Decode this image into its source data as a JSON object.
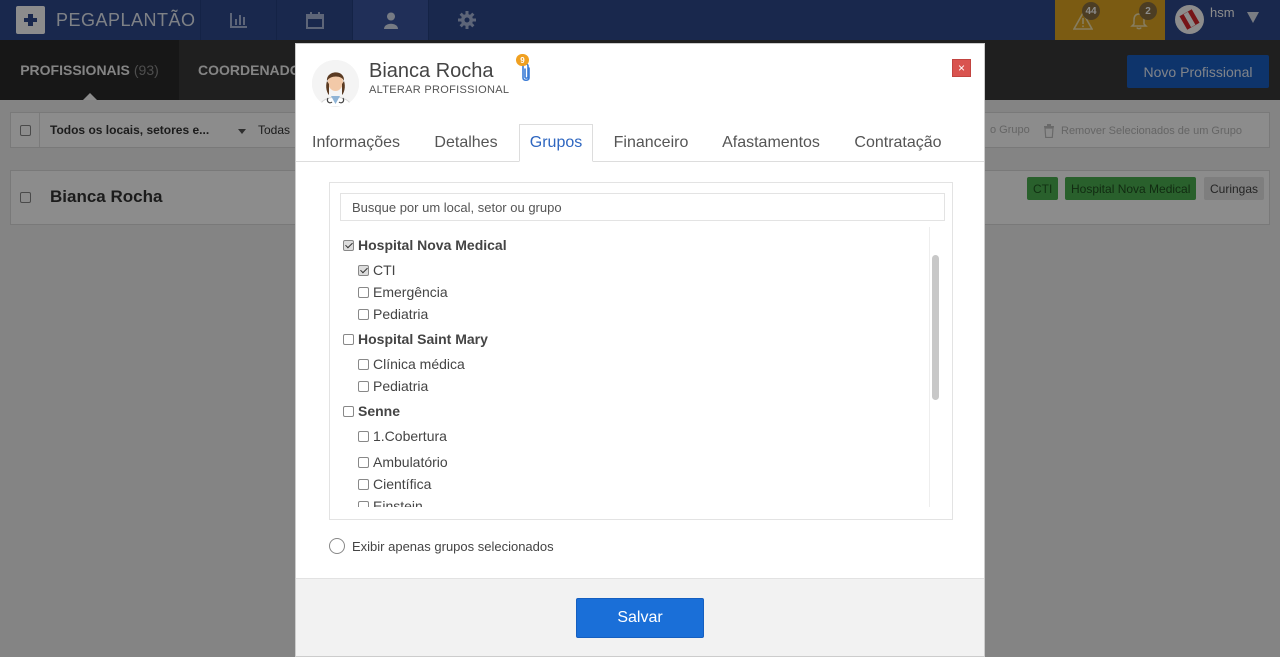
{
  "app": {
    "name": "PEGAPLANTÃO"
  },
  "topnav": {
    "tabs": [
      {
        "icon": "bar-chart-icon"
      },
      {
        "icon": "calendar-icon"
      },
      {
        "icon": "user-icon",
        "active": true
      },
      {
        "icon": "gear-icon"
      }
    ],
    "alerts": {
      "warnings": "44",
      "notifications": "2"
    },
    "user": {
      "name": "hsm"
    }
  },
  "subnav": {
    "tab_active": "PROFISSIONAIS",
    "tab_active_count": "(93)",
    "tab_2": "COORDENADO",
    "new_button": "Novo Profissional"
  },
  "filters": {
    "locations": "Todos os locais, setores e...",
    "todas": "Todas",
    "add_group_fragment": "o Grupo",
    "remove_selected": "Remover Selecionados de um Grupo"
  },
  "list": {
    "rows": [
      {
        "name": "Bianca Rocha",
        "tags": [
          "CTI",
          "Hospital Nova Medical",
          "Curingas"
        ]
      }
    ]
  },
  "modal": {
    "title": "Bianca Rocha",
    "subtitle": "ALTERAR PROFISSIONAL",
    "attachments_count": "9",
    "close": "×",
    "tabs": [
      "Informações",
      "Detalhes",
      "Grupos",
      "Financeiro",
      "Afastamentos",
      "Contratação"
    ],
    "active_tab": "Grupos",
    "search_placeholder": "Busque por um local, setor ou grupo",
    "groups": [
      {
        "label": "Hospital Nova Medical",
        "checked": true,
        "children": [
          {
            "label": "CTI",
            "checked": true
          },
          {
            "label": "Emergência",
            "checked": false
          },
          {
            "label": "Pediatria",
            "checked": false
          }
        ]
      },
      {
        "label": "Hospital Saint Mary",
        "checked": false,
        "children": [
          {
            "label": "Clínica médica",
            "checked": false
          },
          {
            "label": "Pediatria",
            "checked": false
          }
        ]
      },
      {
        "label": "Senne",
        "checked": false,
        "children": [
          {
            "label": "1.Cobertura",
            "checked": false
          },
          {
            "label": "Ambulatório",
            "checked": false
          },
          {
            "label": "Científica",
            "checked": false
          },
          {
            "label": "Einstein",
            "checked": false
          }
        ]
      }
    ],
    "only_selected_label": "Exibir apenas grupos selecionados",
    "save_button": "Salvar"
  },
  "colors": {
    "navbar": "#2e4a8c",
    "alerts": "#e0a721",
    "subbar": "#3a3a3a",
    "primary": "#1a6fd8",
    "tag_green": "#4caf50",
    "close": "#d9534f"
  }
}
